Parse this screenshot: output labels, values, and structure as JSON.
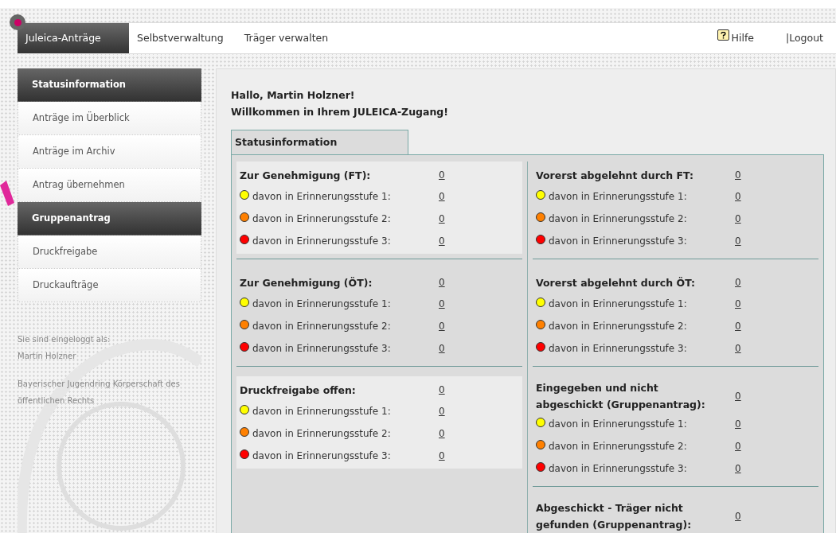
{
  "nav": {
    "tabs": [
      {
        "label": "Juleica-Anträge",
        "selected": true
      },
      {
        "label": "Selbstverwaltung",
        "selected": false
      },
      {
        "label": "Träger verwalten",
        "selected": false
      }
    ],
    "help": "Hilfe",
    "logout": "|Logout"
  },
  "sidebar": {
    "items": [
      {
        "label": "Statusinformation",
        "selected": true
      },
      {
        "label": "Anträge im Überblick",
        "selected": false
      },
      {
        "label": "Anträge im Archiv",
        "selected": false
      },
      {
        "label": "Antrag übernehmen",
        "selected": false
      },
      {
        "label": "Gruppenantrag",
        "selected": true
      },
      {
        "label": "Druckfreigabe",
        "selected": false
      },
      {
        "label": "Druckaufträge",
        "selected": false
      }
    ],
    "login_label": "Sie sind eingeloggt als:",
    "user": "Martin Holzner",
    "organization": "Bayerischer Jugendring Körperschaft des öffentlichen Rechts"
  },
  "main": {
    "greeting": "Hallo, Martin Holzner!",
    "welcome": "Willkommen in Ihrem JULEICA-Zugang!",
    "tab": "Statusinformation",
    "columns": [
      {
        "sections": [
          {
            "title": "Zur Genehmigung (FT):",
            "count": "0",
            "highlighted": true,
            "rows": [
              {
                "label": "davon in Erinnerungsstufe 1:",
                "count": "0",
                "color": "#ffff00"
              },
              {
                "label": "davon in Erinnerungsstufe 2:",
                "count": "0",
                "color": "#ff8000"
              },
              {
                "label": "davon in Erinnerungsstufe 3:",
                "count": "0",
                "color": "#ff0000"
              }
            ]
          },
          {
            "title": "Zur Genehmigung (ÖT):",
            "count": "0",
            "highlighted": false,
            "rows": [
              {
                "label": "davon in Erinnerungsstufe 1:",
                "count": "0",
                "color": "#ffff00"
              },
              {
                "label": "davon in Erinnerungsstufe 2:",
                "count": "0",
                "color": "#ff8000"
              },
              {
                "label": "davon in Erinnerungsstufe 3:",
                "count": "0",
                "color": "#ff0000"
              }
            ]
          },
          {
            "title": "Druckfreigabe offen:",
            "count": "0",
            "highlighted": true,
            "rows": [
              {
                "label": "davon in Erinnerungsstufe 1:",
                "count": "0",
                "color": "#ffff00"
              },
              {
                "label": "davon in Erinnerungsstufe 2:",
                "count": "0",
                "color": "#ff8000"
              },
              {
                "label": "davon in Erinnerungsstufe 3:",
                "count": "0",
                "color": "#ff0000"
              }
            ]
          }
        ]
      },
      {
        "sections": [
          {
            "title": "Vorerst abgelehnt durch FT:",
            "count": "0",
            "highlighted": false,
            "rows": [
              {
                "label": "davon in Erinnerungsstufe 1:",
                "count": "0",
                "color": "#ffff00"
              },
              {
                "label": "davon in Erinnerungsstufe 2:",
                "count": "0",
                "color": "#ff8000"
              },
              {
                "label": "davon in Erinnerungsstufe 3:",
                "count": "0",
                "color": "#ff0000"
              }
            ]
          },
          {
            "title": "Vorerst abgelehnt durch ÖT:",
            "count": "0",
            "highlighted": false,
            "rows": [
              {
                "label": "davon in Erinnerungsstufe 1:",
                "count": "0",
                "color": "#ffff00"
              },
              {
                "label": "davon in Erinnerungsstufe 2:",
                "count": "0",
                "color": "#ff8000"
              },
              {
                "label": "davon in Erinnerungsstufe 3:",
                "count": "0",
                "color": "#ff0000"
              }
            ]
          },
          {
            "title": "Eingegeben und nicht abgeschickt (Gruppenantrag):",
            "count": "0",
            "highlighted": false,
            "rows": [
              {
                "label": "davon in Erinnerungsstufe 1:",
                "count": "0",
                "color": "#ffff00"
              },
              {
                "label": "davon in Erinnerungsstufe 2:",
                "count": "0",
                "color": "#ff8000"
              },
              {
                "label": "davon in Erinnerungsstufe 3:",
                "count": "0",
                "color": "#ff0000"
              }
            ]
          },
          {
            "title": "Abgeschickt - Träger nicht gefunden (Gruppenantrag):",
            "count": "0",
            "highlighted": false
          }
        ]
      }
    ]
  }
}
